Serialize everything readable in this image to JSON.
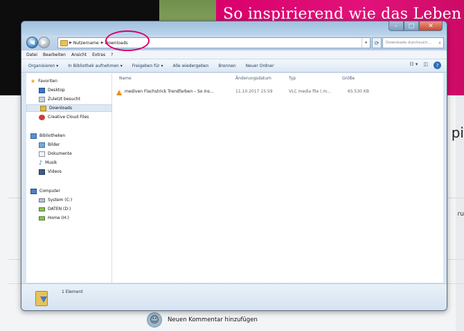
{
  "background_page": {
    "headline": "So inspirierend wie das Leben",
    "side_text_1": "pi",
    "side_text_2": "ru",
    "comment_label": "Neuen Kommentar hinzufügen"
  },
  "window": {
    "controls": [
      "–",
      "□",
      "✕"
    ],
    "address": {
      "crumbs": [
        "Nutzername",
        "Downloads"
      ],
      "dropdown": "▾"
    },
    "search_placeholder": "Downloads durchsuch...",
    "menu": [
      "Datei",
      "Bearbeiten",
      "Ansicht",
      "Extras",
      "?"
    ],
    "toolbar": [
      "Organisieren ▾",
      "In Bibliothek aufnehmen ▾",
      "Freigeben für ▾",
      "Alle wiedergeben",
      "Brennen",
      "Neuer Ordner"
    ],
    "nav": {
      "favorites_header": "Favoriten",
      "favorites": [
        "Desktop",
        "Zuletzt besucht",
        "Downloads",
        "Creative Cloud Files"
      ],
      "libraries_header": "Bibliotheken",
      "libraries": [
        "Bilder",
        "Dokumente",
        "Musik",
        "Videos"
      ],
      "computer_header": "Computer",
      "drives": [
        "System (C:)",
        "DATEN (D:)",
        "Home (H:)"
      ]
    },
    "columns": [
      "Name",
      "Änderungsdatum",
      "Typ",
      "Größe"
    ],
    "files": [
      {
        "name": "mediven Flachstrick Trendfarben – So ins...",
        "date": "11.10.2017 15:59",
        "type": "VLC media file (.m...",
        "size": "65.530 KB"
      }
    ],
    "status": "1 Element"
  }
}
